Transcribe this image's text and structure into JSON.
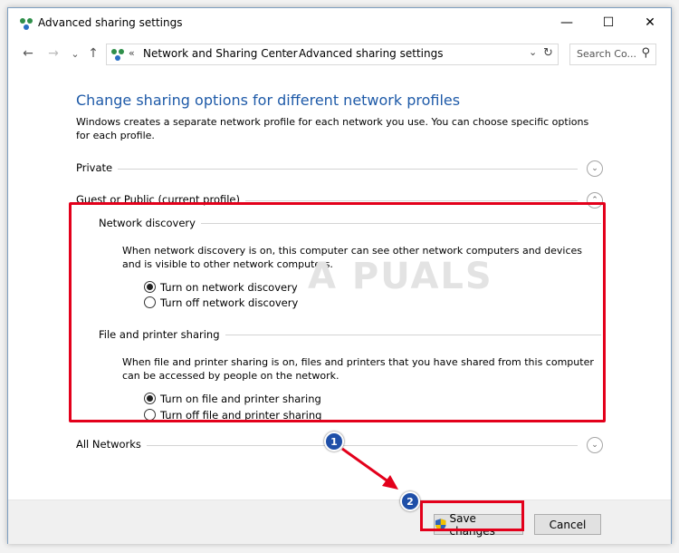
{
  "window": {
    "title": "Advanced sharing settings",
    "controls": {
      "minimize": "—",
      "maximize": "☐",
      "close": "✕"
    }
  },
  "address": {
    "back": "←",
    "forward": "→",
    "recent": "⌄",
    "up": "↑",
    "chevrons": "«",
    "crumbs": [
      "Network and Sharing Center",
      "Advanced sharing settings"
    ],
    "separator": "›",
    "dropdown": "⌄",
    "refresh": "↻",
    "search_placeholder": "Search Co...",
    "search_icon": "⚲"
  },
  "content": {
    "heading": "Change sharing options for different network profiles",
    "description": "Windows creates a separate network profile for each network you use. You can choose specific options for each profile.",
    "profiles": {
      "private": {
        "label": "Private",
        "chevron": "⌄"
      },
      "guest": {
        "label": "Guest or Public (current profile)",
        "chevron": "⌃"
      },
      "all": {
        "label": "All Networks",
        "chevron": "⌄"
      }
    },
    "network_discovery": {
      "title": "Network discovery",
      "text": "When network discovery is on, this computer can see other network computers and devices and is visible to other network computers.",
      "options": [
        "Turn on network discovery",
        "Turn off network discovery"
      ],
      "selected": 0
    },
    "file_sharing": {
      "title": "File and printer sharing",
      "text": "When file and printer sharing is on, files and printers that you have shared from this computer can be accessed by people on the network.",
      "options": [
        "Turn on file and printer sharing",
        "Turn off file and printer sharing"
      ],
      "selected": 0
    },
    "watermark": "A  PUALS"
  },
  "annotations": {
    "step1": "1",
    "step2": "2",
    "highlight_color": "#e3001b",
    "step_color": "#1f4fa8"
  },
  "footer": {
    "save_label": "Save changes",
    "cancel_label": "Cancel"
  }
}
